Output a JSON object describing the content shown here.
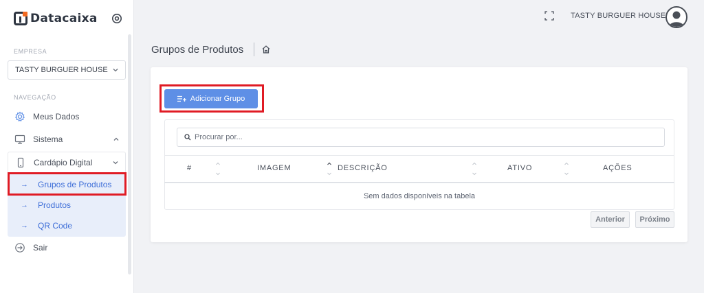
{
  "brand": {
    "name": "Datacaixa"
  },
  "sidebar": {
    "company_label": "EMPRESA",
    "company_value": "TASTY BURGUER HOUSE",
    "nav_label": "NAVEGAÇÃO",
    "items": [
      {
        "label": "Meus Dados",
        "icon": "gear-icon"
      },
      {
        "label": "Sistema",
        "icon": "monitor-icon"
      },
      {
        "label": "Cardápio Digital",
        "icon": "mobile-icon"
      },
      {
        "label": "Sair",
        "icon": "logout-icon"
      }
    ],
    "submenu": [
      {
        "label": "Grupos de Produtos",
        "active": true
      },
      {
        "label": "Produtos"
      },
      {
        "label": "QR Code"
      }
    ]
  },
  "topbar": {
    "user_name": "TASTY BURGUER HOUSE"
  },
  "breadcrumb": {
    "title": "Grupos de Produtos"
  },
  "main": {
    "add_button": "Adicionar Grupo",
    "search_placeholder": "Procurar por...",
    "columns": [
      "#",
      "IMAGEM",
      "DESCRIÇÃO",
      "ATIVO",
      "AÇÕES"
    ],
    "empty_text": "Sem dados disponíveis na tabela",
    "prev_label": "Anterior",
    "next_label": "Próximo"
  },
  "colors": {
    "accent": "#5e8fe6",
    "highlight": "#e01b24",
    "submenu_bg": "#e8eefa",
    "link": "#3f6fd8",
    "logo_orange": "#f26a21"
  }
}
